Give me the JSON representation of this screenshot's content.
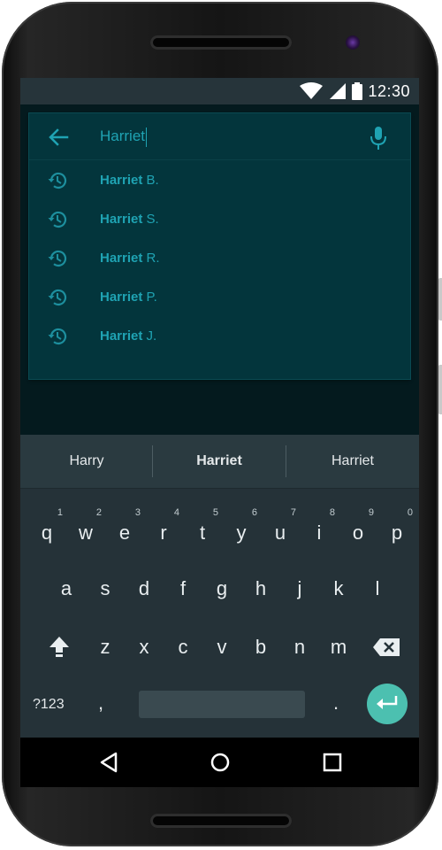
{
  "status_bar": {
    "time": "12:30",
    "icons": [
      "wifi-icon",
      "signal-icon",
      "battery-icon"
    ]
  },
  "search": {
    "query": "Harriet",
    "back_icon": "arrow-back-icon",
    "mic_icon": "microphone-icon"
  },
  "suggestions": [
    {
      "bold": "Harriet",
      "rest": " B."
    },
    {
      "bold": "Harriet",
      "rest": " S."
    },
    {
      "bold": "Harriet",
      "rest": " R."
    },
    {
      "bold": "Harriet",
      "rest": " P."
    },
    {
      "bold": "Harriet",
      "rest": " J."
    }
  ],
  "keyboard": {
    "predictions": [
      "Harry",
      "Harriet",
      "Harriet"
    ],
    "row1": [
      "q",
      "w",
      "e",
      "r",
      "t",
      "y",
      "u",
      "i",
      "o",
      "p"
    ],
    "row1_hints": [
      "1",
      "2",
      "3",
      "4",
      "5",
      "6",
      "7",
      "8",
      "9",
      "0"
    ],
    "row2": [
      "a",
      "s",
      "d",
      "f",
      "g",
      "h",
      "j",
      "k",
      "l"
    ],
    "row3": [
      "z",
      "x",
      "c",
      "v",
      "b",
      "n",
      "m"
    ],
    "symbols_label": "?123",
    "comma": ",",
    "period": "."
  },
  "colors": {
    "accent": "#1fa3b3",
    "panel": "#03353c",
    "keyboard": "#253238",
    "enter": "#4cc0b0"
  }
}
